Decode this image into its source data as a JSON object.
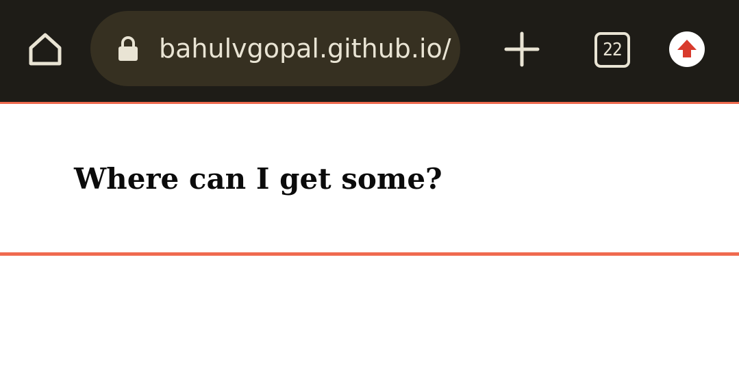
{
  "browser": {
    "url": "bahulvgopal.github.io/",
    "tab_count": "22",
    "icons": {
      "home": "home-icon",
      "lock": "lock-icon",
      "new_tab": "plus-icon",
      "tabs": "tab-switcher-icon",
      "extension": "upload-arrow-icon"
    },
    "colors": {
      "toolbar": "#1e1c17",
      "url_bar": "#363021",
      "accent": "#ee6a4e",
      "icon": "#e9e4d4",
      "extension_arrow": "#d83a2c"
    }
  },
  "page": {
    "heading": "Where can I get some?"
  }
}
